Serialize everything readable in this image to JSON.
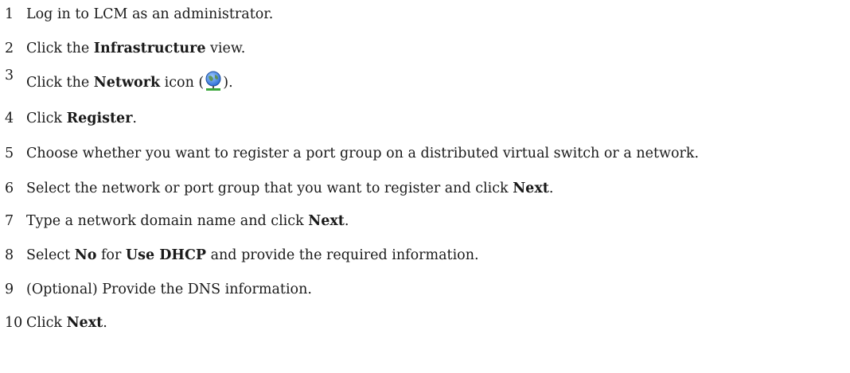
{
  "steps": [
    {
      "number": "1",
      "parts": [
        {
          "text": "Log in to LCM as an administrator.",
          "bold": false
        }
      ]
    },
    {
      "number": "2",
      "parts": [
        {
          "text": "Click the ",
          "bold": false
        },
        {
          "text": "Infrastructure",
          "bold": true
        },
        {
          "text": " view.",
          "bold": false
        }
      ]
    },
    {
      "number": "3",
      "parts": [
        {
          "text": "Click the ",
          "bold": false
        },
        {
          "text": "Network",
          "bold": true
        },
        {
          "text": " icon (",
          "bold": false
        },
        {
          "icon": "network-globe-icon"
        },
        {
          "text": ").",
          "bold": false
        }
      ]
    },
    {
      "number": "4",
      "parts": [
        {
          "text": "Click ",
          "bold": false
        },
        {
          "text": "Register",
          "bold": true
        },
        {
          "text": ".",
          "bold": false
        }
      ]
    },
    {
      "number": "5",
      "parts": [
        {
          "text": "Choose whether you want to register a port group on a distributed virtual switch or a network.",
          "bold": false
        }
      ]
    },
    {
      "number": "6",
      "parts": [
        {
          "text": "Select the network or port group that you want to register and click ",
          "bold": false
        },
        {
          "text": "Next",
          "bold": true
        },
        {
          "text": ".",
          "bold": false
        }
      ]
    },
    {
      "number": "7",
      "parts": [
        {
          "text": "Type a network domain name and click ",
          "bold": false
        },
        {
          "text": "Next",
          "bold": true
        },
        {
          "text": ".",
          "bold": false
        }
      ]
    },
    {
      "number": "8",
      "parts": [
        {
          "text": "Select ",
          "bold": false
        },
        {
          "text": "No",
          "bold": true
        },
        {
          "text": " for ",
          "bold": false
        },
        {
          "text": "Use DHCP",
          "bold": true
        },
        {
          "text": " and provide the required information.",
          "bold": false
        }
      ]
    },
    {
      "number": "9",
      "parts": [
        {
          "text": "(Optional) Provide the DNS information.",
          "bold": false
        }
      ]
    },
    {
      "number": "10",
      "parts": [
        {
          "text": "Click ",
          "bold": false
        },
        {
          "text": "Next",
          "bold": true
        },
        {
          "text": ".",
          "bold": false
        }
      ]
    }
  ],
  "colors": {
    "text": "#1a1a1a",
    "icon_globe": "#2f6fd6",
    "icon_base": "#3aa63a"
  }
}
